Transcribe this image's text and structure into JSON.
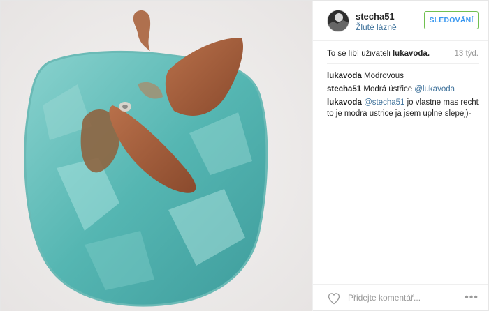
{
  "post": {
    "author": "stecha51",
    "location": "Žluté lázně",
    "follow_label": "SLEDOVÁNÍ",
    "likes_prefix": "To se líbí uživateli",
    "likes_user": "lukavoda.",
    "age": "13 týd.",
    "comments": [
      {
        "user": "lukavoda",
        "parts": [
          {
            "text": " Modrovous",
            "mention": false
          }
        ]
      },
      {
        "user": "stecha51",
        "parts": [
          {
            "text": " Modrá ústřice ",
            "mention": false
          },
          {
            "text": "@lukavoda",
            "mention": true
          }
        ]
      },
      {
        "user": "lukavoda",
        "parts": [
          {
            "text": " ",
            "mention": false
          },
          {
            "text": "@stecha51",
            "mention": true
          },
          {
            "text": " jo vlastne mas recht to je modra ustrice ja jsem uplne slepej)-",
            "mention": false
          }
        ]
      }
    ],
    "comment_placeholder": "Přidejte komentář...",
    "more_glyph": "•••"
  },
  "icons": {
    "heart": "heart-outline-icon",
    "more": "more-options-icon"
  },
  "colors": {
    "link": "#3f729b",
    "follow_border": "#70c050",
    "follow_text": "#3897f0",
    "muted": "#999999"
  }
}
